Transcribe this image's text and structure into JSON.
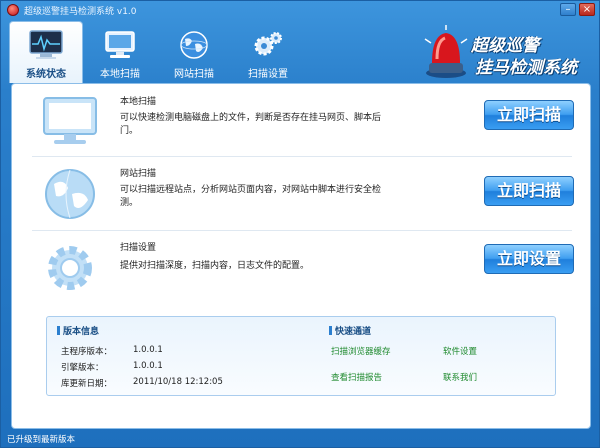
{
  "window": {
    "title": "超级巡警挂马检测系统 v1.0"
  },
  "tabs": [
    {
      "label": "系统状态",
      "icon": "monitor-pulse-icon",
      "active": true
    },
    {
      "label": "本地扫描",
      "icon": "computer-icon",
      "active": false
    },
    {
      "label": "网站扫描",
      "icon": "globe-icon",
      "active": false
    },
    {
      "label": "扫描设置",
      "icon": "gears-icon",
      "active": false
    }
  ],
  "brand": {
    "line1": "超级巡警",
    "line2": "挂马检测系统",
    "icon": "police-siren-icon"
  },
  "sections": [
    {
      "title": "本地扫描",
      "desc": "可以快速检测电脑磁盘上的文件，判断是否存在挂马网页、脚本后门。",
      "button": "立即扫描",
      "icon": "monitor-icon"
    },
    {
      "title": "网站扫描",
      "desc": "可以扫描远程站点，分析网站页面内容，对网站中脚本进行安全检测。",
      "button": "立即扫描",
      "icon": "globe-icon"
    },
    {
      "title": "扫描设置",
      "desc": "提供对扫描深度，扫描内容，日志文件的配置。",
      "button": "立即设置",
      "icon": "gear-icon"
    }
  ],
  "version_info": {
    "heading": "版本信息",
    "rows": [
      {
        "label": "主程序版本：",
        "value": "1.0.0.1"
      },
      {
        "label": "引擎版本：",
        "value": "1.0.0.1"
      },
      {
        "label": "库更新日期：",
        "value": "2011/10/18 12:12:05"
      }
    ]
  },
  "quick": {
    "heading": "快速通道",
    "links": [
      "扫描浏览器缓存",
      "软件设置",
      "查看扫描报告",
      "联系我们"
    ]
  },
  "status": {
    "text": "已升级到最新版本"
  },
  "colors": {
    "accent": "#2a7fcb",
    "link": "#1f8a2e",
    "button": "#3f9ef0"
  }
}
